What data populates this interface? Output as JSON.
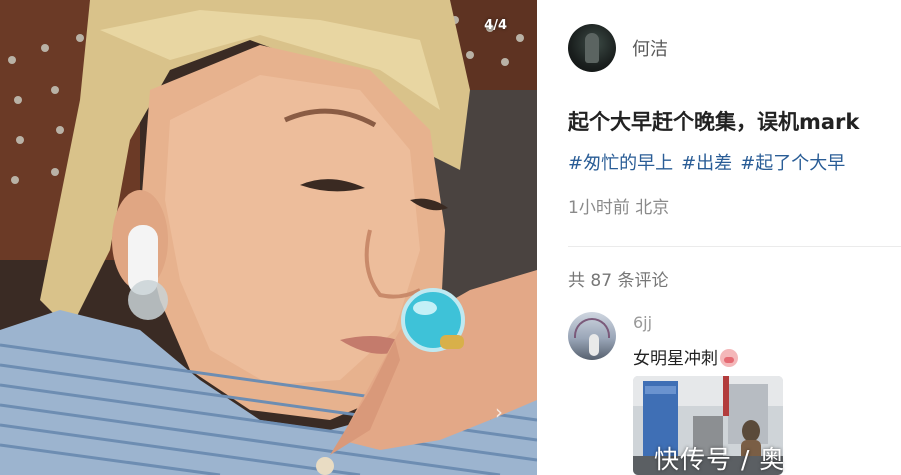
{
  "photo": {
    "page_indicator": "4/4",
    "next_arrow": "›"
  },
  "post": {
    "author_name": "何洁",
    "title": "起个大早赶个晚集，误机mark",
    "tags": [
      "#匆忙的早上",
      "#出差",
      "#起了个大早"
    ],
    "meta": "1小时前 北京"
  },
  "comments": {
    "count_label": "共 87 条评论",
    "items": [
      {
        "username": "6jj",
        "text": "女明星冲刺",
        "emoji": "pig-face-emoji"
      }
    ]
  },
  "watermark": "快传号 / 奥",
  "colors": {
    "tag": "#2a5d96",
    "title": "#222222",
    "meta": "#8a8a8a"
  }
}
